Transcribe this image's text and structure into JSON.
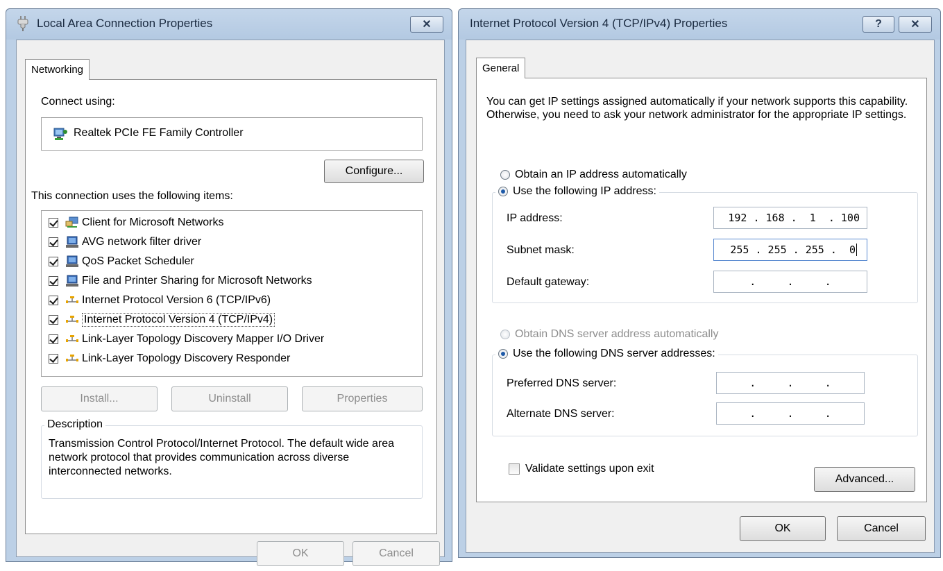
{
  "left_window": {
    "title": "Local Area Connection Properties",
    "close_label": "✕",
    "tab_label": "Networking",
    "connect_using_label": "Connect using:",
    "adapter_name": "Realtek PCIe FE Family Controller",
    "configure_label": "Configure...",
    "items_label": "This connection uses the following items:",
    "items": [
      {
        "label": "Client for Microsoft Networks",
        "checked": true,
        "icon": "network-client-icon"
      },
      {
        "label": "AVG network filter driver",
        "checked": true,
        "icon": "network-service-icon"
      },
      {
        "label": "QoS Packet Scheduler",
        "checked": true,
        "icon": "network-service-icon"
      },
      {
        "label": "File and Printer Sharing for Microsoft Networks",
        "checked": true,
        "icon": "network-service-icon"
      },
      {
        "label": "Internet Protocol Version 6 (TCP/IPv6)",
        "checked": true,
        "icon": "protocol-icon"
      },
      {
        "label": "Internet Protocol Version 4 (TCP/IPv4)",
        "checked": true,
        "icon": "protocol-icon"
      },
      {
        "label": "Link-Layer Topology Discovery Mapper I/O Driver",
        "checked": true,
        "icon": "protocol-icon"
      },
      {
        "label": "Link-Layer Topology Discovery Responder",
        "checked": true,
        "icon": "protocol-icon"
      }
    ],
    "install_label": "Install...",
    "uninstall_label": "Uninstall",
    "properties_label": "Properties",
    "description_legend": "Description",
    "description_text": "Transmission Control Protocol/Internet Protocol. The default wide area network protocol that provides communication across diverse interconnected networks.",
    "ok_label": "OK",
    "cancel_label": "Cancel"
  },
  "right_window": {
    "title": "Internet Protocol Version 4 (TCP/IPv4) Properties",
    "help_label": "?",
    "close_label": "✕",
    "tab_label": "General",
    "intro_text": "You can get IP settings assigned automatically if your network supports this capability. Otherwise, you need to ask your network administrator for the appropriate IP settings.",
    "obtain_ip_label": "Obtain an IP address automatically",
    "use_ip_label": "Use the following IP address:",
    "ip_address_label": "IP address:",
    "ip_address_value": "192 . 168 .  1  . 100",
    "subnet_mask_label": "Subnet mask:",
    "subnet_mask_value": "255 . 255 . 255 .  0",
    "gateway_label": "Default gateway:",
    "gateway_value": ".     .     .",
    "obtain_dns_label": "Obtain DNS server address automatically",
    "use_dns_label": "Use the following DNS server addresses:",
    "preferred_dns_label": "Preferred DNS server:",
    "preferred_dns_value": ".     .     .",
    "alternate_dns_label": "Alternate DNS server:",
    "alternate_dns_value": ".     .     .",
    "validate_label": "Validate settings upon exit",
    "advanced_label": "Advanced...",
    "ok_label": "OK",
    "cancel_label": "Cancel"
  }
}
